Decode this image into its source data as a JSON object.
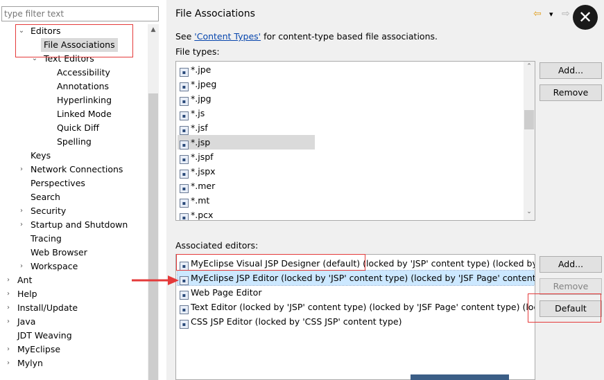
{
  "filter": {
    "placeholder": "type filter text"
  },
  "tree": [
    {
      "label": "Editors",
      "indent": 1,
      "twisty": "down"
    },
    {
      "label": "File Associations",
      "indent": 2,
      "twisty": "",
      "selected": true
    },
    {
      "label": "Text Editors",
      "indent": 2,
      "twisty": "down"
    },
    {
      "label": "Accessibility",
      "indent": 3,
      "twisty": ""
    },
    {
      "label": "Annotations",
      "indent": 3,
      "twisty": ""
    },
    {
      "label": "Hyperlinking",
      "indent": 3,
      "twisty": ""
    },
    {
      "label": "Linked Mode",
      "indent": 3,
      "twisty": ""
    },
    {
      "label": "Quick Diff",
      "indent": 3,
      "twisty": ""
    },
    {
      "label": "Spelling",
      "indent": 3,
      "twisty": ""
    },
    {
      "label": "Keys",
      "indent": 1,
      "twisty": ""
    },
    {
      "label": "Network Connections",
      "indent": 1,
      "twisty": "right"
    },
    {
      "label": "Perspectives",
      "indent": 1,
      "twisty": ""
    },
    {
      "label": "Search",
      "indent": 1,
      "twisty": ""
    },
    {
      "label": "Security",
      "indent": 1,
      "twisty": "right"
    },
    {
      "label": "Startup and Shutdown",
      "indent": 1,
      "twisty": "right"
    },
    {
      "label": "Tracing",
      "indent": 1,
      "twisty": ""
    },
    {
      "label": "Web Browser",
      "indent": 1,
      "twisty": ""
    },
    {
      "label": "Workspace",
      "indent": 1,
      "twisty": "right"
    },
    {
      "label": "Ant",
      "indent": 0,
      "twisty": "right"
    },
    {
      "label": "Help",
      "indent": 0,
      "twisty": "right"
    },
    {
      "label": "Install/Update",
      "indent": 0,
      "twisty": "right"
    },
    {
      "label": "Java",
      "indent": 0,
      "twisty": "right"
    },
    {
      "label": "JDT Weaving",
      "indent": 0,
      "twisty": ""
    },
    {
      "label": "MyEclipse",
      "indent": 0,
      "twisty": "right"
    },
    {
      "label": "Mylyn",
      "indent": 0,
      "twisty": "right"
    }
  ],
  "header": {
    "title": "File Associations",
    "back": "⇦",
    "dropdown": "▾",
    "forward": "⇨",
    "close": "✕"
  },
  "see_text": {
    "prefix": "See ",
    "link": "'Content Types'",
    "suffix": " for content-type based file associations."
  },
  "file_types_label": "File types:",
  "file_types": [
    {
      "name": "*.jpe",
      "icon": "image-icon"
    },
    {
      "name": "*.jpeg",
      "icon": "image-icon"
    },
    {
      "name": "*.jpg",
      "icon": "image-icon"
    },
    {
      "name": "*.js",
      "icon": "js-file-icon"
    },
    {
      "name": "*.jsf",
      "icon": "jsf-file-icon"
    },
    {
      "name": "*.jsp",
      "icon": "jsp-file-icon",
      "selected": true
    },
    {
      "name": "*.jspf",
      "icon": "jsp-file-icon"
    },
    {
      "name": "*.jspx",
      "icon": "jsp-file-icon"
    },
    {
      "name": "*.mer",
      "icon": "mer-file-icon"
    },
    {
      "name": "*.mt",
      "icon": "text-file-icon"
    },
    {
      "name": "*.pcx",
      "icon": "image-icon"
    }
  ],
  "file_type_buttons": {
    "add": "Add...",
    "remove": "Remove"
  },
  "editors_label": "Associated editors:",
  "editors": [
    {
      "name": "MyEclipse Visual JSP Designer (default) (locked by 'JSP' content type) (locked by 'JSF",
      "icon": "jsp-designer-icon"
    },
    {
      "name": "MyEclipse JSP Editor (locked by 'JSP' content type) (locked by 'JSF Page' content type",
      "icon": "jsp-editor-icon",
      "selected": true
    },
    {
      "name": "Web Page Editor",
      "icon": "web-page-icon"
    },
    {
      "name": "Text Editor (locked by 'JSP' content type) (locked by 'JSF Page' content type) (locked",
      "icon": "text-editor-icon"
    },
    {
      "name": "CSS JSP Editor (locked by 'CSS JSP' content type)",
      "icon": "css-editor-icon"
    }
  ],
  "editor_buttons": {
    "add": "Add...",
    "remove": "Remove",
    "default": "Default"
  },
  "colors": {
    "accent_red": "#e43a3a",
    "selection": "#cce8ff",
    "link": "#0645ad"
  }
}
